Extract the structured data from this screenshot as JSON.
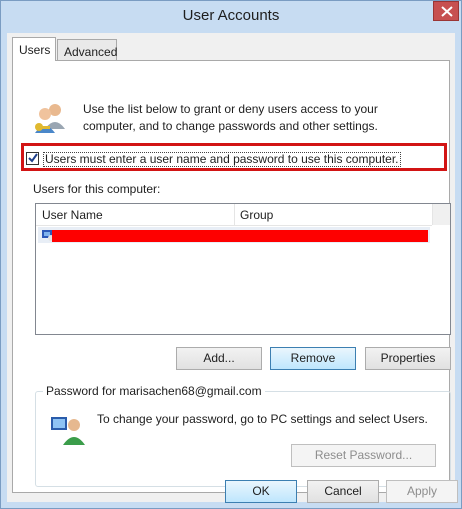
{
  "window": {
    "title": "User Accounts"
  },
  "tabs": [
    {
      "label": "Users"
    },
    {
      "label": "Advanced"
    }
  ],
  "intro": {
    "text": "Use the list below to grant or deny users access to your computer, and to change passwords and other settings."
  },
  "checkbox": {
    "label": "Users must enter a user name and password to use this computer.",
    "checked": true
  },
  "users_list": {
    "label": "Users for this computer:",
    "columns": [
      "User Name",
      "Group"
    ]
  },
  "buttons": {
    "add": "Add...",
    "remove": "Remove",
    "properties": "Properties"
  },
  "password_group": {
    "title": "Password for marisachen68@gmail.com",
    "text": "To change your password, go to PC settings and select Users.",
    "reset_label": "Reset Password..."
  },
  "dialog_buttons": {
    "ok": "OK",
    "cancel": "Cancel",
    "apply": "Apply"
  },
  "colors": {
    "highlight_border": "#d21414",
    "redaction": "#fe0000",
    "title_bg": "#c7dcf2"
  },
  "icons": {
    "users": "users-icon",
    "user_row": "user-icon",
    "password": "user-password-icon",
    "close": "close-icon"
  }
}
